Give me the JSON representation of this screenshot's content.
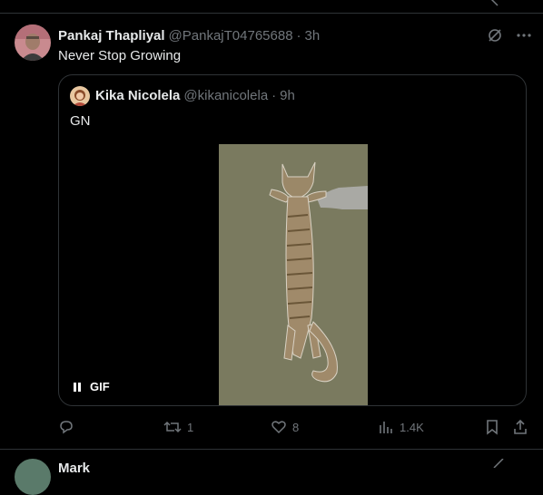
{
  "tweet": {
    "author_name": "Pankaj Thapliyal",
    "handle": "@PankajT04765688",
    "separator": "·",
    "time": "3h",
    "text": "Never Stop Growing"
  },
  "quoted": {
    "author_name": "Kika Nicolela",
    "handle": "@kikanicolela",
    "separator": "·",
    "time": "9h",
    "text": "GN",
    "media_badge": "GIF"
  },
  "actions": {
    "reply_count": "",
    "retweet_count": "1",
    "like_count": "8",
    "views_count": "1.4K"
  },
  "next_tweet": {
    "author_name_partial": "Mark"
  },
  "icons": {
    "grok": "grok-icon",
    "more": "more-icon",
    "reply": "reply-icon",
    "retweet": "retweet-icon",
    "like": "heart-icon",
    "views": "views-icon",
    "bookmark": "bookmark-icon",
    "share": "share-icon"
  },
  "colors": {
    "background": "#000000",
    "text": "#e7e9ea",
    "muted": "#71767b",
    "border": "#2f3336",
    "media_bg": "#7a7a5f"
  }
}
